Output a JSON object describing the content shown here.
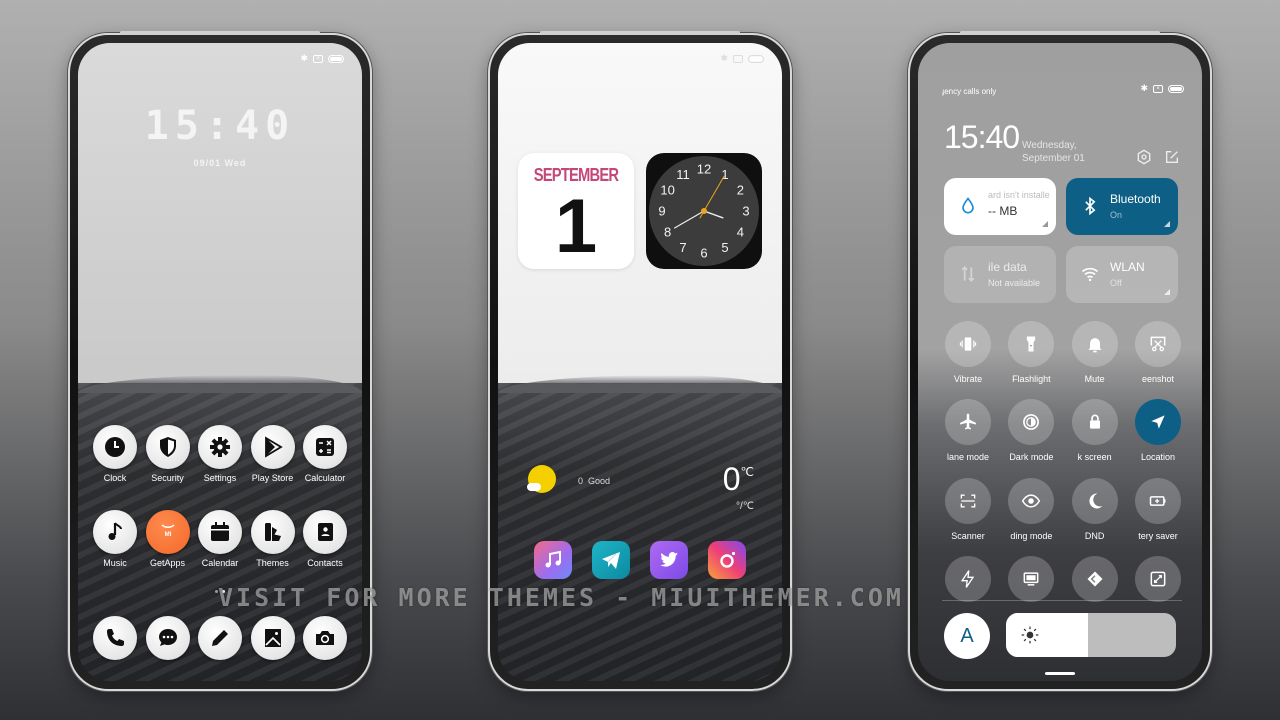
{
  "watermark": "VISIT FOR MORE THEMES - MIUITHEMER.COM",
  "phone1": {
    "lock_time": "15:40",
    "lock_date": "09/01 Wed",
    "apps_row1": [
      {
        "label": "Clock",
        "icon": "clock-icon"
      },
      {
        "label": "Security",
        "icon": "shield-icon"
      },
      {
        "label": "Settings",
        "icon": "gear-icon"
      },
      {
        "label": "Play Store",
        "icon": "play-store-icon"
      },
      {
        "label": "Calculator",
        "icon": "calculator-icon"
      }
    ],
    "apps_row2": [
      {
        "label": "Music",
        "icon": "music-note-icon"
      },
      {
        "label": "GetApps",
        "icon": "mi-getapps-icon"
      },
      {
        "label": "Calendar",
        "icon": "calendar-icon"
      },
      {
        "label": "Themes",
        "icon": "themes-icon"
      },
      {
        "label": "Contacts",
        "icon": "contacts-icon"
      }
    ],
    "dock": [
      {
        "icon": "phone-icon"
      },
      {
        "icon": "message-icon"
      },
      {
        "icon": "pencil-icon"
      },
      {
        "icon": "gallery-icon"
      },
      {
        "icon": "camera-icon"
      }
    ],
    "page_indicator": {
      "pages": 2,
      "current": 2
    }
  },
  "phone2": {
    "calendar_month": "SEPTEMBER",
    "calendar_day": "1",
    "clock_numbers": [
      "12",
      "1",
      "2",
      "3",
      "4",
      "5",
      "6",
      "7",
      "8",
      "9",
      "10",
      "11"
    ],
    "clock_time": {
      "hour": 15,
      "minute": 40,
      "second": 5
    },
    "weather": {
      "aqi_value": "0",
      "aqi_label": "Good",
      "temp": "0",
      "unit": "℃",
      "range": "°/℃"
    },
    "dock": [
      {
        "name": "Music",
        "icon": "music-note-icon"
      },
      {
        "name": "Telegram",
        "icon": "paper-plane-icon"
      },
      {
        "name": "Twitter",
        "icon": "bird-icon"
      },
      {
        "name": "Instagram",
        "icon": "camera-ring-icon"
      }
    ],
    "colors": {
      "calendar_month": "#c54678",
      "clock_hand_second": "#e8a623"
    }
  },
  "phone3": {
    "carrier_text": "ɟency calls only",
    "time": "15:40",
    "date_line1": "Wednesday,",
    "date_line2": "September 01",
    "tiles": [
      {
        "title": "ard isn't installe",
        "subtitle": "-- MB",
        "icon": "water-drop-icon",
        "state": "white"
      },
      {
        "title": "Bluetooth",
        "subtitle": "On",
        "icon": "bluetooth-icon",
        "state": "active"
      },
      {
        "title": "ile data",
        "subtitle": "Not available",
        "icon": "mobile-data-icon",
        "state": "disabled"
      },
      {
        "title": "WLAN",
        "subtitle": "Off",
        "icon": "wifi-icon",
        "state": "off"
      }
    ],
    "toggles_row1": [
      {
        "label": "Vibrate",
        "icon": "vibrate-icon"
      },
      {
        "label": "Flashlight",
        "icon": "flashlight-icon"
      },
      {
        "label": "Mute",
        "icon": "bell-icon"
      },
      {
        "label": "eenshot",
        "icon": "screenshot-icon"
      }
    ],
    "toggles_row2": [
      {
        "label": "lane mode",
        "icon": "airplane-icon"
      },
      {
        "label": "Dark mode",
        "icon": "dark-mode-icon"
      },
      {
        "label": "k screen",
        "icon": "lock-icon"
      },
      {
        "label": "Location",
        "icon": "location-arrow-icon",
        "active": true
      }
    ],
    "toggles_row3": [
      {
        "label": "Scanner",
        "icon": "scanner-icon"
      },
      {
        "label": "ding mode",
        "icon": "eye-icon"
      },
      {
        "label": "DND",
        "icon": "moon-icon"
      },
      {
        "label": "tery saver",
        "icon": "battery-plus-icon"
      }
    ],
    "toggles_row4": [
      {
        "icon": "bolt-icon"
      },
      {
        "icon": "cast-screen-icon"
      },
      {
        "icon": "code-diamond-icon"
      },
      {
        "icon": "resize-icon"
      }
    ],
    "auto_brightness_label": "A",
    "brightness_fraction": 0.48,
    "colors": {
      "active": "#0e5f86"
    }
  }
}
